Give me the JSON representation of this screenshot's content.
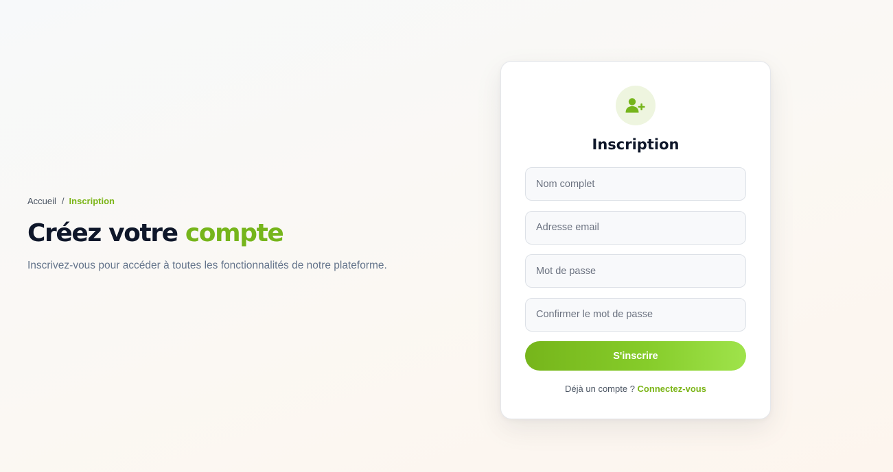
{
  "colors": {
    "accent": "#7cb518",
    "accent_light": "#a0e34d",
    "heading": "#0f172a",
    "muted": "#64748b",
    "icon_bg": "#eef5df"
  },
  "breadcrumb": {
    "home": "Accueil",
    "separator": "/",
    "current": "Inscription"
  },
  "hero": {
    "title_part1": "Créez votre",
    "title_accent": "compte",
    "subtitle": "Inscrivez-vous pour accéder à toutes les fonctionnalités de notre plateforme."
  },
  "card": {
    "icon": "user-plus-icon",
    "title": "Inscription",
    "fields": {
      "name": {
        "placeholder": "Nom complet",
        "value": ""
      },
      "email": {
        "placeholder": "Adresse email",
        "value": ""
      },
      "password": {
        "placeholder": "Mot de passe",
        "value": ""
      },
      "confirm": {
        "placeholder": "Confirmer le mot de passe",
        "value": ""
      }
    },
    "submit_label": "S'inscrire",
    "login_prompt": "Déjà un compte ? ",
    "login_link": "Connectez-vous"
  }
}
